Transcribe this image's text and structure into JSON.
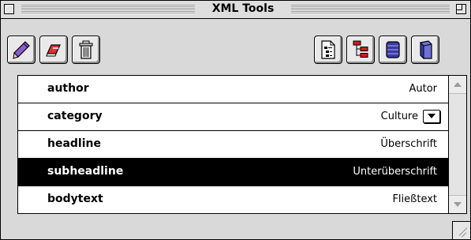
{
  "window": {
    "title": "XML Tools"
  },
  "toolbar": {
    "left_buttons": [
      {
        "icon": "pencil-icon"
      },
      {
        "icon": "eraser-icon"
      },
      {
        "icon": "trash-icon"
      }
    ],
    "right_buttons": [
      {
        "icon": "document-icon"
      },
      {
        "icon": "tree-structure-icon"
      },
      {
        "icon": "database-icon"
      },
      {
        "icon": "book-icon"
      }
    ]
  },
  "list": {
    "rows": [
      {
        "name": "author",
        "value": "Autor",
        "selected": false
      },
      {
        "name": "category",
        "value": "Culture",
        "selected": false,
        "has_popup": true
      },
      {
        "name": "headline",
        "value": "Überschrift",
        "selected": false
      },
      {
        "name": "subheadline",
        "value": "Unterüberschrift",
        "selected": true
      },
      {
        "name": "bodytext",
        "value": "Fließtext",
        "selected": false
      }
    ]
  },
  "colors": {
    "selection_background": "#000000",
    "selection_text": "#ffffff",
    "icon_purple": "#7a50c0",
    "icon_red": "#d81818",
    "icon_blue": "#3a3aa8"
  }
}
